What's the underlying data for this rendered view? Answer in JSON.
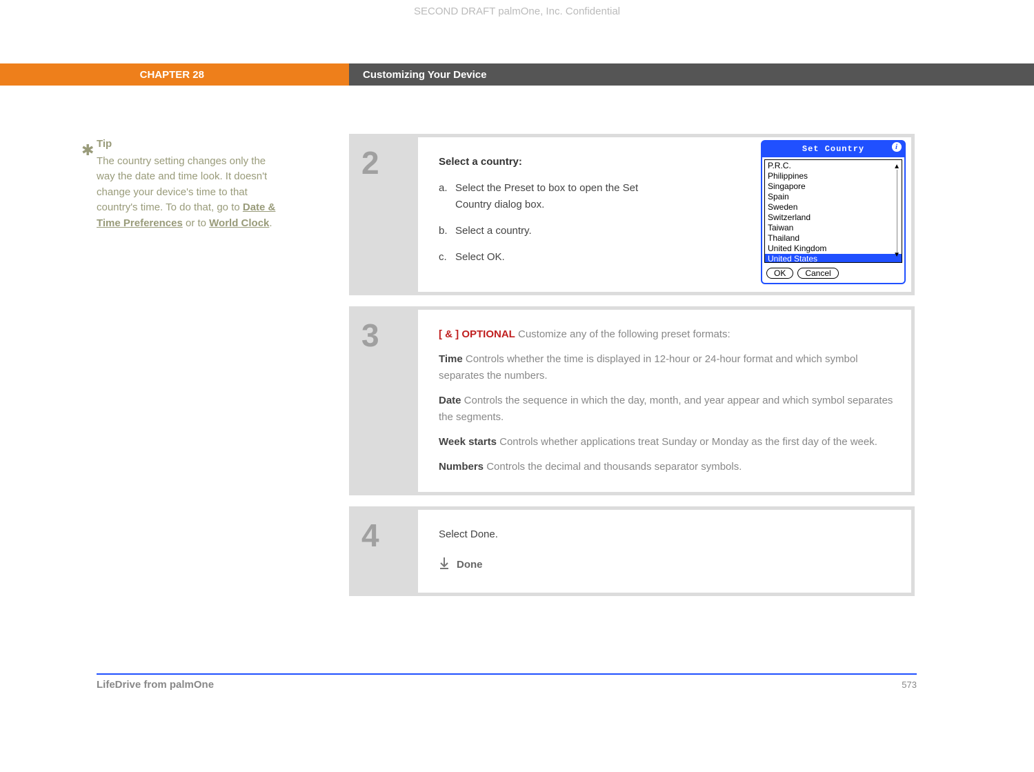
{
  "watermark": "SECOND DRAFT palmOne, Inc.  Confidential",
  "chapter": {
    "label": "CHAPTER 28",
    "title": "Customizing Your Device"
  },
  "tip": {
    "heading": "Tip",
    "body_pre": "The country setting changes only the way the date and time look. It doesn't change your device's time to that country's time. To do that, go to ",
    "link1": "Date & Time Preferences",
    "body_mid": " or to ",
    "link2": "World Clock",
    "body_end": "."
  },
  "step2": {
    "num": "2",
    "heading": "Select a country:",
    "a_marker": "a.",
    "a_text": "Select the Preset to box to open the Set Country dialog box.",
    "b_marker": "b.",
    "b_text": "Select a country.",
    "c_marker": "c.",
    "c_text": "Select OK."
  },
  "dialog": {
    "title": "Set Country",
    "items": [
      "P.R.C.",
      "Philippines",
      "Singapore",
      "Spain",
      "Sweden",
      "Switzerland",
      "Taiwan",
      "Thailand",
      "United Kingdom",
      "United States"
    ],
    "selected_index": 9,
    "ok": "OK",
    "cancel": "Cancel"
  },
  "step3": {
    "num": "3",
    "tag_prefix": "[ & ]  OPTIONAL",
    "tag_suffix": "   Customize any of the following preset formats:",
    "time_label": "Time",
    "time_desc": "   Controls whether the time is displayed in 12-hour or 24-hour format and which symbol separates the numbers.",
    "date_label": "Date",
    "date_desc": "   Controls the sequence in which the day, month, and year appear and which symbol separates the segments.",
    "week_label": "Week starts",
    "week_desc": "   Controls whether applications treat Sunday or Monday as the first day of the week.",
    "num_label": "Numbers",
    "num_desc": "   Controls the decimal and thousands separator symbols."
  },
  "step4": {
    "num": "4",
    "text": "Select Done.",
    "done_label": "Done"
  },
  "footer": {
    "left": "LifeDrive from palmOne",
    "page": "573"
  }
}
